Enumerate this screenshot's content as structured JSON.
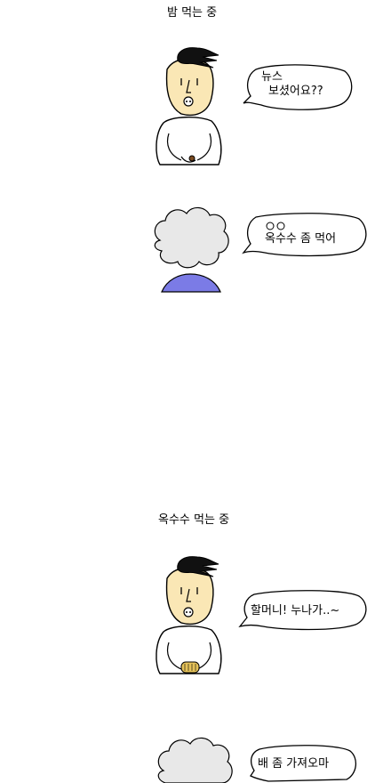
{
  "panels": [
    {
      "caption": "밤 먹는 중",
      "bubble_1": {
        "line_1": "뉴스",
        "line_2": "보셨어요??"
      },
      "bubble_2": {
        "text": "옥수수 좀 먹어"
      }
    },
    {
      "caption": "옥수수 먹는 중",
      "bubble_1": {
        "text": "할머니! 누나가..~"
      },
      "bubble_2": {
        "text": "배 좀 가져오마"
      }
    }
  ],
  "colors": {
    "skin": "#FAE7B5",
    "hair": "#111111",
    "grandma_hair": "#E8E8E8",
    "grandma_clothes": "#7B7BE6",
    "shirt": "#FFFFFF"
  },
  "icons": {
    "boy": "boy-face-icon",
    "grandma": "grandma-face-icon"
  }
}
